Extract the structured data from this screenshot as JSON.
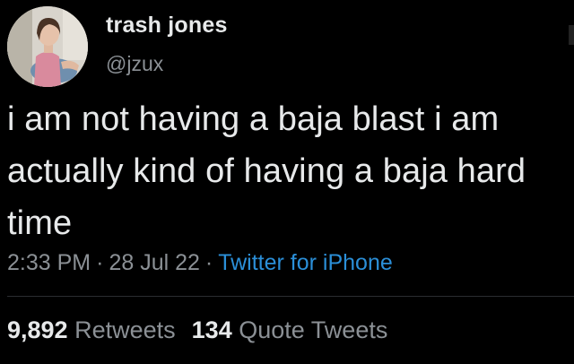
{
  "author": {
    "name": "trash jones",
    "handle": "@jzux"
  },
  "tweet": {
    "text": "i am not having a baja blast i am actually kind of having a baja hard time"
  },
  "meta": {
    "time": "2:33 PM",
    "separator": "·",
    "date": "28 Jul 22",
    "source": "Twitter for iPhone"
  },
  "stats": {
    "retweets_count": "9,892",
    "retweets_label": "Retweets",
    "quotes_count": "134",
    "quotes_label": "Quote Tweets"
  },
  "colors": {
    "background": "#000000",
    "text": "#e7e9ea",
    "muted": "#8b9095",
    "link": "#2b8fd8"
  },
  "icons": {
    "avatar": "avatar-photo"
  }
}
